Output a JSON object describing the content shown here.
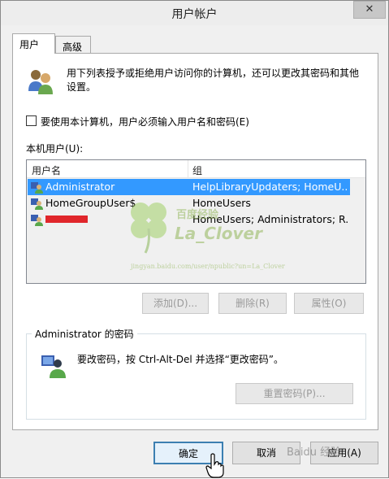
{
  "window": {
    "title": "用户帐户",
    "close_glyph": "✕"
  },
  "tabs": [
    {
      "label": "用户",
      "active": true
    },
    {
      "label": "高级",
      "active": false
    }
  ],
  "intro": {
    "icon": "users-group-icon",
    "text": "用下列表授予或拒绝用户访问你的计算机，还可以更改其密码和其他设置。"
  },
  "require_login": {
    "checked": false,
    "label": "要使用本计算机，用户必须输入用户名和密码(E)"
  },
  "local_users": {
    "label": "本机用户(U):",
    "columns": [
      "用户名",
      "组"
    ],
    "rows": [
      {
        "name": "Administrator",
        "group": "HelpLibraryUpdaters; HomeU...",
        "selected": true
      },
      {
        "name": "HomeGroupUser$",
        "group": "HomeUsers",
        "selected": false
      },
      {
        "name": "",
        "group": "HomeUsers; Administrators; R...",
        "selected": false,
        "redacted": true
      }
    ]
  },
  "watermark": {
    "brand": "百度经验",
    "name": "La_Clover",
    "url": "jingyan.baidu.com/user/npublic?un=La_Clover"
  },
  "list_buttons": {
    "add": "添加(D)...",
    "remove": "删除(R)",
    "properties": "属性(O)"
  },
  "password_group": {
    "title": "Administrator 的密码",
    "text": "要改密码，按 Ctrl-Alt-Del 并选择“更改密码”。",
    "reset_button": "重置密码(P)..."
  },
  "footer": {
    "ok": "确定",
    "cancel": "取消",
    "apply": "应用(A)",
    "corner_watermark": "Baidu 经验"
  },
  "colors": {
    "selection": "#3399ff",
    "redaction": "#e0262b",
    "ok_border": "#3c7fb1"
  }
}
